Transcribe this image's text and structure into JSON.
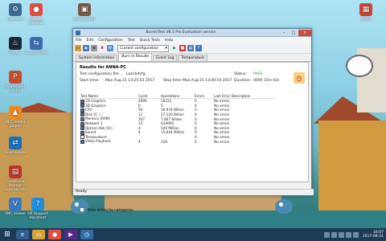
{
  "desktop": {
    "icons": [
      {
        "label": "Lcovidan",
        "glyph": "⚙",
        "color": "#3c6a95"
      },
      {
        "label": "Google Chrome",
        "glyph": "●",
        "color": "#e84c3d"
      },
      {
        "label": "Steam",
        "glyph": "♨",
        "color": "#1b2838"
      },
      {
        "label": "GlobalSCAPE",
        "glyph": "⇆",
        "color": "#3d6bb3"
      },
      {
        "label": "PowerPoint 2013",
        "glyph": "P",
        "color": "#c84c2c"
      },
      {
        "label": "VLC media player",
        "glyph": "▲",
        "color": "#f08a1c"
      },
      {
        "label": "TeamViewer",
        "glyph": "⇄",
        "color": "#1a6ec3"
      },
      {
        "label": "Command Prompt commander",
        "glyph": "▤",
        "color": "#c2332b"
      },
      {
        "label": "VNC Viewer",
        "glyph": "V",
        "color": "#3a78c8"
      },
      {
        "label": "HP Support Assistant",
        "glyph": "?",
        "color": "#1c8fe0"
      },
      {
        "label": "Burnit 2014",
        "glyph": "▣",
        "color": "#7a5a40"
      },
      {
        "label": "2018",
        "glyph": "▦",
        "color": "#c43"
      }
    ]
  },
  "window": {
    "title": "BurnInTest V8.1 Pro Evaluation version",
    "menu": [
      "File",
      "Edit",
      "Configuration",
      "Test",
      "Quick Tests",
      "Help"
    ],
    "toolbar": {
      "config": "Current configuration"
    },
    "tabs": [
      "System Information",
      "Burn In Results",
      "Event Log",
      "Temperature"
    ],
    "results_title": "Results for ANNA-PC",
    "test_config_label": "Test configuration file:",
    "test_config_value": "Last.bitcfg",
    "start_label": "Start time:",
    "start_value": "Mon Aug 21 13:25:52 2017",
    "stop_label": "Stop time:",
    "stop_value": "Mon Aug 21 13:40:54 2017",
    "status_label": "Status:",
    "status_value": "PASS",
    "duration_label": "Duration:",
    "duration_value": "000h 15m 02s",
    "table": {
      "headers": [
        "Test Name",
        "Cycle",
        "Operations",
        "Errors",
        "Last Error Description"
      ],
      "rows": [
        {
          "name": "2D Graphics",
          "cycle": "2099",
          "ops": "16315",
          "err": "0",
          "desc": "No errors",
          "on": true
        },
        {
          "name": "3D Graphics",
          "cycle": "0",
          "ops": "5",
          "err": "0",
          "desc": "No errors",
          "on": true
        },
        {
          "name": "CPU",
          "cycle": "50",
          "ops": "56.974 Billion",
          "err": "0",
          "desc": "No errors",
          "on": true
        },
        {
          "name": "Disk (C: )",
          "cycle": "11",
          "ops": "27.120 Billion",
          "err": "0",
          "desc": "No errors",
          "on": true
        },
        {
          "name": "Memory (RAM)",
          "cycle": "207",
          "ops": "7.607 Billion",
          "err": "0",
          "desc": "No errors",
          "on": true
        },
        {
          "name": "Network 1",
          "cycle": "15",
          "ops": "634000",
          "err": "0",
          "desc": "No errors",
          "on": true
        },
        {
          "name": "Optical disk (D:)",
          "cycle": "4",
          "ops": "549 Million",
          "err": "0",
          "desc": "No errors",
          "on": true
        },
        {
          "name": "Sound",
          "cycle": "4",
          "ops": "15.644 Million",
          "err": "0",
          "desc": "No errors",
          "on": true
        },
        {
          "name": "Temperature",
          "cycle": "",
          "ops": "",
          "err": "0",
          "desc": "No errors",
          "on": false
        },
        {
          "name": "Video Playback",
          "cycle": "4",
          "ops": "129",
          "err": "0",
          "desc": "No errors",
          "on": true
        }
      ]
    },
    "view_errors": "View errors by categories",
    "status_bar": "Ready"
  },
  "taskbar": {
    "time": "16:07",
    "date": "2017-08-21"
  }
}
